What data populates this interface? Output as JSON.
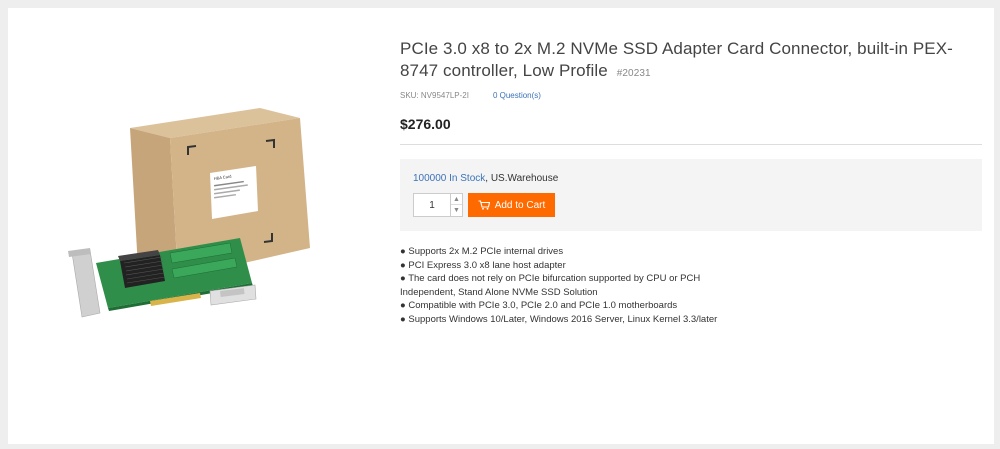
{
  "product": {
    "title": "PCIe 3.0 x8 to 2x M.2 NVMe SSD Adapter Card Connector, built-in PEX-8747 controller, Low Profile",
    "item_number": "#20231",
    "sku_label": "SKU:",
    "sku": "NV9547LP-2I",
    "questions": "0 Question(s)",
    "price": "$276.00"
  },
  "buy_box": {
    "stock_qty": "100000 In Stock",
    "stock_suffix": ", US.Warehouse",
    "quantity": "1",
    "add_to_cart": "Add to Cart"
  },
  "image": {
    "box_label": "HBA Card"
  },
  "features": [
    "● Supports 2x M.2 PCIe internal drives",
    "● PCI Express 3.0 x8 lane host adapter",
    "● The card does not rely on PCIe bifurcation supported by CPU or PCH",
    "Independent, Stand Alone NVMe SSD Solution",
    "● Compatible with PCIe 3.0, PCIe 2.0 and PCIe 1.0 motherboards",
    "● Supports Windows 10/Later, Windows 2016 Server, Linux Kernel 3.3/later"
  ],
  "colors": {
    "accent": "#ff6a00",
    "link": "#3b73b9",
    "box": "#c9a77c",
    "pcb": "#2f8f4a"
  }
}
